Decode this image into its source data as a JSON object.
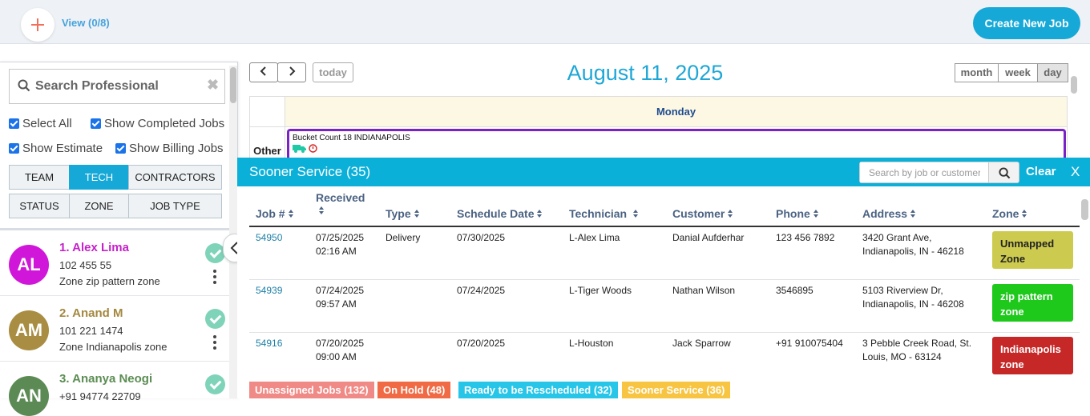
{
  "header": {
    "view_label": "View (0/8)",
    "create_job_label": "Create New Job"
  },
  "sidebar": {
    "search_placeholder": "Search Professional",
    "checkboxes": [
      "Select All",
      "Show Completed Jobs",
      "Show Estimate",
      "Show Billing Jobs"
    ],
    "filter_buttons": [
      "TEAM",
      "TECH",
      "CONTRACTORS",
      "STATUS",
      "ZONE",
      "JOB TYPE"
    ],
    "active_filter": "TECH",
    "professionals": [
      {
        "initials": "AL",
        "name": "1. Alex Lima",
        "phone": "102 455 55",
        "zone": "Zone zip pattern zone",
        "color": "#d017d9",
        "name_color": "#c521c9"
      },
      {
        "initials": "AM",
        "name": "2. Anand M",
        "phone": "101 221 1474",
        "zone": "Zone Indianapolis zone",
        "color": "#a98d43",
        "name_color": "#a4883f"
      },
      {
        "initials": "AN",
        "name": "3. Ananya Neogi",
        "phone": "+91 94774 22709",
        "zone": "",
        "color": "#5c8a54",
        "name_color": "#5b8c52"
      }
    ]
  },
  "calendar": {
    "today_label": "today",
    "title": "August 11, 2025",
    "views": [
      "month",
      "week",
      "day"
    ],
    "active_view": "day",
    "day_header": "Monday",
    "row_label": "Other",
    "event_title": "Bucket Count 18 INDIANAPOLIS"
  },
  "sooner_service": {
    "title": "Sooner Service (35)",
    "search_placeholder": "Search by job or customer",
    "clear_label": "Clear",
    "close_label": "X",
    "columns": [
      "Job #",
      "Received",
      "Type",
      "Schedule Date",
      "Technician",
      "Customer",
      "Phone",
      "Address",
      "Zone"
    ],
    "rows": [
      {
        "job": "54950",
        "received_date": "07/25/2025",
        "received_time": "02:16 AM",
        "type": "Delivery",
        "schedule": "07/30/2025",
        "technician": "L-Alex Lima",
        "customer": "Danial Aufderhar",
        "phone": "123 456 7892",
        "address1": "3420 Grant Ave,",
        "address2": "Indianapolis, IN - 46218",
        "zone1": "Unmapped",
        "zone2": "Zone",
        "zone_bg": "#cdcb4f",
        "zone_fg": "#222222"
      },
      {
        "job": "54939",
        "received_date": "07/24/2025",
        "received_time": "09:57 AM",
        "type": "",
        "schedule": "07/24/2025",
        "technician": "L-Tiger Woods",
        "customer": "Nathan Wilson",
        "phone": "3546895",
        "address1": "5103 Riverview Dr,",
        "address2": "Indianapolis, IN - 46208",
        "zone1": "zip pattern",
        "zone2": "zone",
        "zone_bg": "#1ec91c",
        "zone_fg": "#ffffff"
      },
      {
        "job": "54916",
        "received_date": "07/20/2025",
        "received_time": "09:00 AM",
        "type": "",
        "schedule": "07/20/2025",
        "technician": "L-Houston",
        "customer": "Jack Sparrow",
        "phone": "+91 910075404",
        "address1": "3 Pebble Creek Road, St.",
        "address2": "Louis, MO - 63124",
        "zone1": "Indianapolis",
        "zone2": "zone",
        "zone_bg": "#c62828",
        "zone_fg": "#ffffff"
      }
    ]
  },
  "bottom_tabs": [
    {
      "label": "Unassigned Jobs (132)",
      "color": "#f08a86"
    },
    {
      "label": "On Hold (48)",
      "color": "#f06b45"
    },
    {
      "label": "Ready to be Rescheduled (32)",
      "color": "#27c6e8"
    },
    {
      "label": "Sooner Service (36)",
      "color": "#f7c542"
    }
  ]
}
